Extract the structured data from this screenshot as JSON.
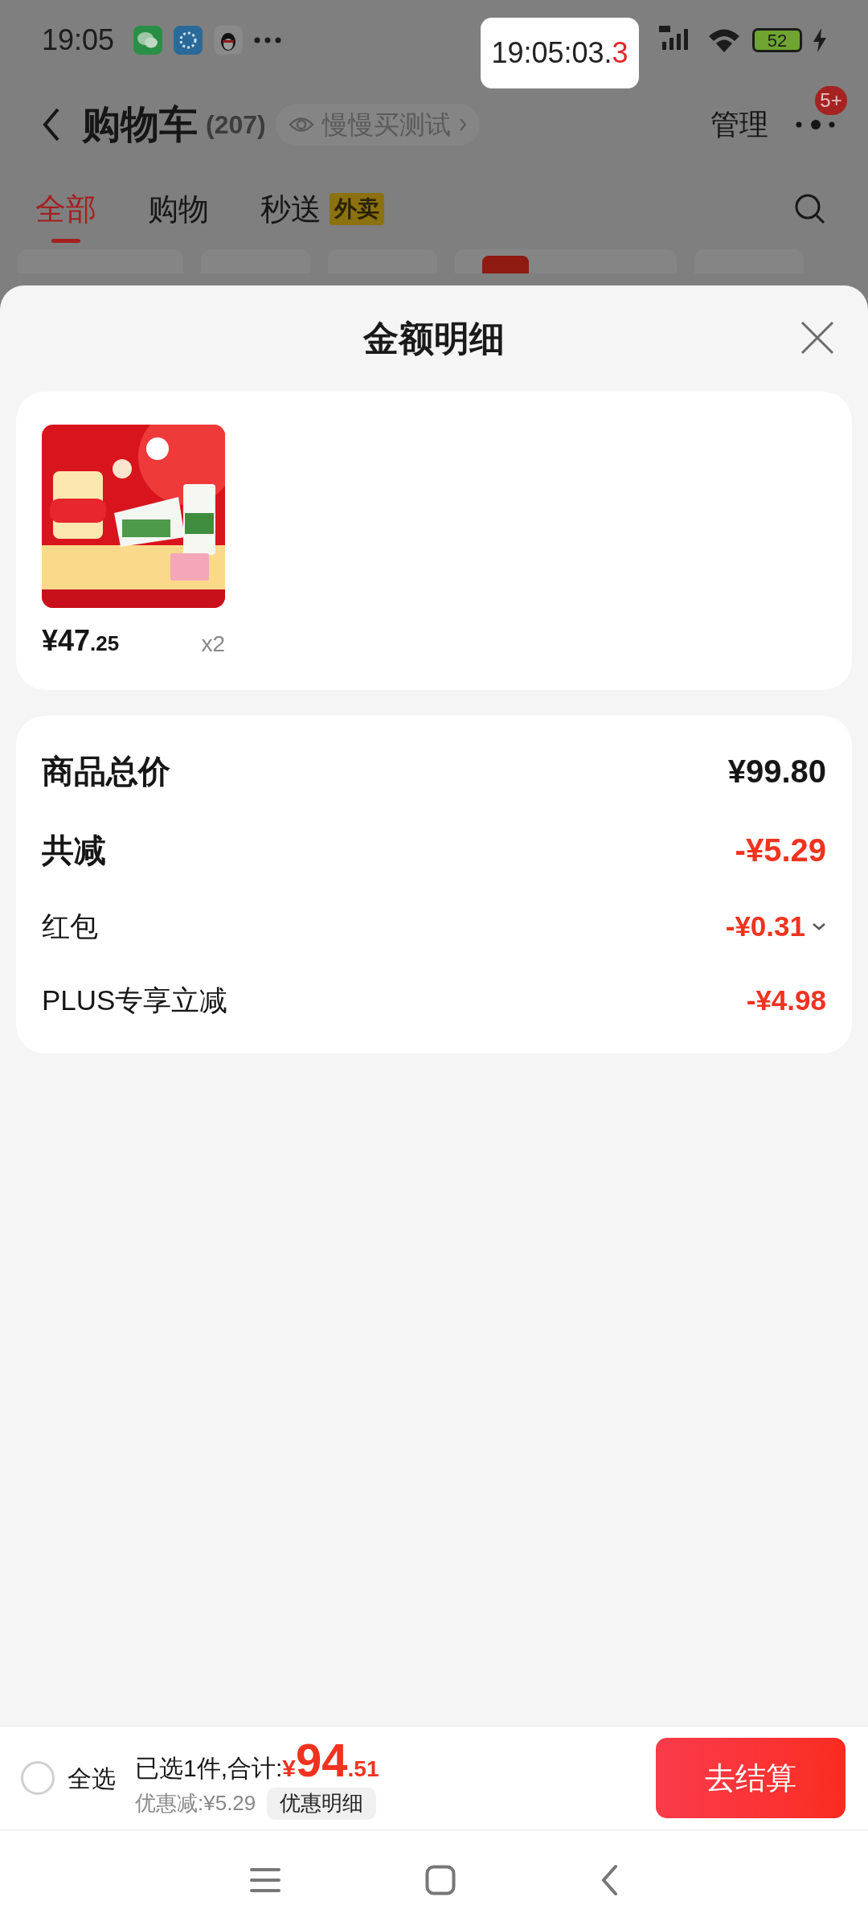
{
  "status_bar": {
    "time": "19:05",
    "battery": "52"
  },
  "clock_overlay": {
    "main": "19:05:03.",
    "tenths": "3"
  },
  "header": {
    "title": "购物车",
    "count": "(207)",
    "pill": "慢慢买测试",
    "manage": "管理",
    "badge": "5+"
  },
  "tabs": [
    {
      "label": "全部",
      "selected": true
    },
    {
      "label": "购物",
      "selected": false
    },
    {
      "label": "秒送",
      "tag": "外卖",
      "selected": false
    }
  ],
  "chips": [
    {
      "promo": false
    },
    {
      "promo": false
    },
    {
      "promo": false
    },
    {
      "promo": true
    },
    {
      "promo": false
    }
  ],
  "sheet": {
    "title": "金额明细",
    "product": {
      "kind": "picture",
      "price_int": "¥47",
      "price_dec": ".25",
      "qty": "x2"
    },
    "rows": [
      {
        "kind": "major",
        "label": "商品总价",
        "value": "¥99.80",
        "discount": false,
        "dropdown": false
      },
      {
        "kind": "major",
        "label": "共减",
        "value": "-¥5.29",
        "discount": true,
        "dropdown": false
      },
      {
        "kind": "minor",
        "label": "红包",
        "value": "-¥0.31",
        "discount": true,
        "dropdown": true
      },
      {
        "kind": "minor",
        "label": "PLUS专享立减",
        "value": "-¥4.98",
        "discount": true,
        "dropdown": false
      }
    ]
  },
  "bottom_bar": {
    "select_all": {
      "label": "全选",
      "checked": false
    },
    "summary": "已选1件,合计:",
    "currency": "¥",
    "total_int": "94",
    "total_dec": ".51",
    "discount": "优惠减:¥5.29",
    "detail_button": "优惠明细",
    "checkout": "去结算"
  }
}
